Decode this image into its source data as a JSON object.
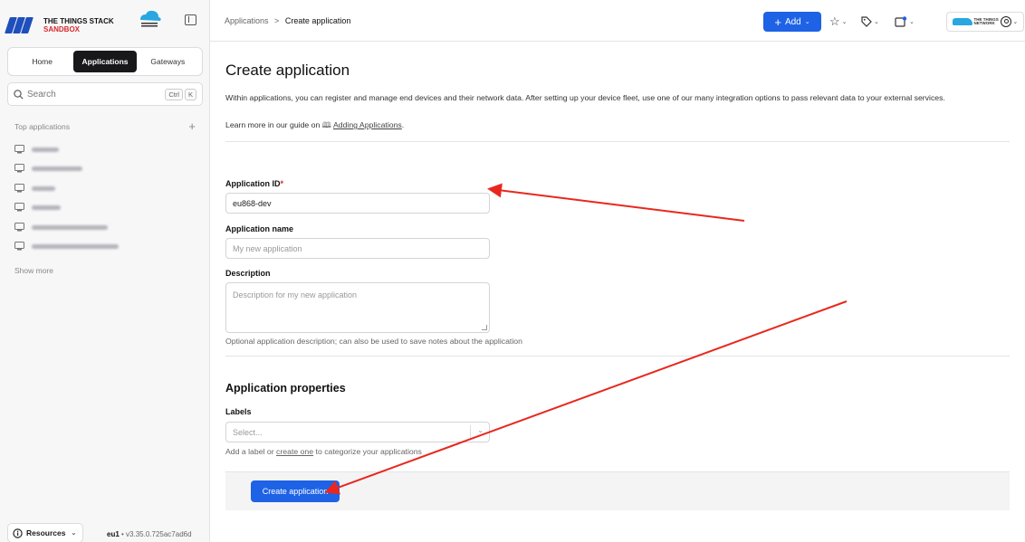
{
  "sidebar": {
    "logo_line1": "THE THINGS STACK",
    "logo_line2": "SANDBOX",
    "tabs": [
      {
        "label": "Home"
      },
      {
        "label": "Applications"
      },
      {
        "label": "Gateways"
      }
    ],
    "search_label": "Search",
    "search_keys": [
      "Ctrl",
      "K"
    ],
    "top_apps_label": "Top applications",
    "show_more": "Show more",
    "resources_label": "Resources",
    "cluster": "eu1",
    "version": "v3.35.0.725ac7ad6d"
  },
  "header": {
    "breadcrumb_root": "Applications",
    "breadcrumb_sep": ">",
    "breadcrumb_current": "Create application",
    "add_label": "Add"
  },
  "main": {
    "title": "Create application",
    "intro": "Within applications, you can register and manage end devices and their network data. After setting up your device fleet, use one of our many integration options to pass relevant data to your external services.",
    "learn_prefix": "Learn more in our guide on",
    "learn_link": "Adding Applications",
    "learn_suffix": ".",
    "app_id_label": "Application ID",
    "app_id_value": "eu868-dev",
    "app_name_label": "Application name",
    "app_name_placeholder": "My new application",
    "description_label": "Description",
    "description_placeholder": "Description for my new application",
    "description_hint": "Optional application description; can also be used to save notes about the application",
    "properties_title": "Application properties",
    "labels_label": "Labels",
    "labels_placeholder": "Select...",
    "labels_hint_prefix": "Add a label or",
    "labels_hint_link": "create one",
    "labels_hint_suffix": "to categorize your applications",
    "submit_label": "Create application"
  },
  "colors": {
    "accent": "#1e62e6",
    "annotation": "#e8281e",
    "required": "#d62a2a"
  }
}
